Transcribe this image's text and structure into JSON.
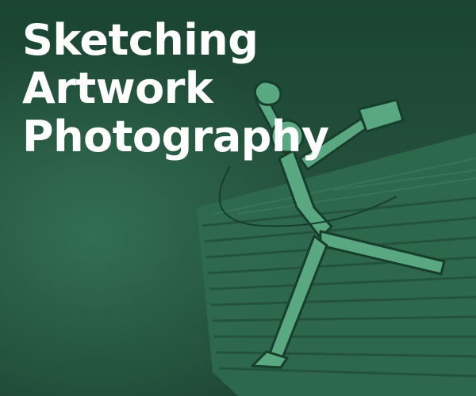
{
  "banner": {
    "title_lines": [
      "Sketching",
      "Artwork",
      "Photography"
    ],
    "background_color": "#1f4e3b",
    "artwork_tint": "#5aa882"
  }
}
